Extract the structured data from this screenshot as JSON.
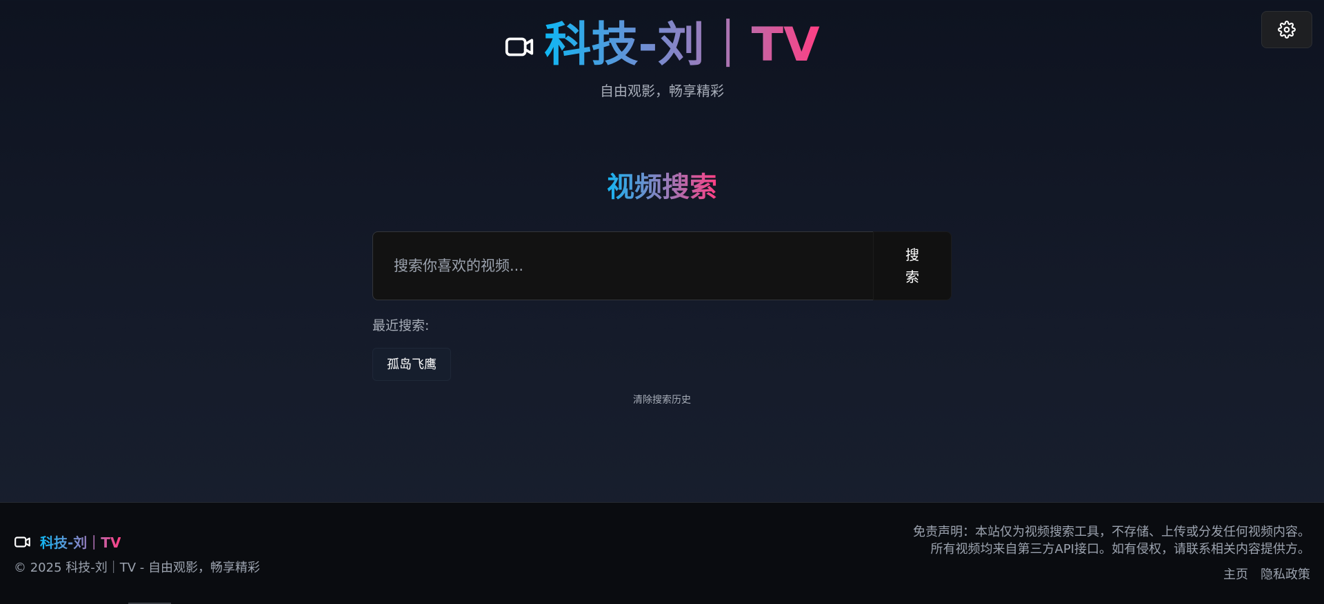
{
  "header": {
    "title": "科技-刘｜TV",
    "tagline": "自由观影，畅享精彩",
    "logo_icon": "video-camera-icon",
    "settings_icon": "gear-icon"
  },
  "search": {
    "heading": "视频搜索",
    "placeholder": "搜索你喜欢的视频...",
    "value": "",
    "button_label": "搜索",
    "recent_label": "最近搜索:",
    "recent_items": [
      "孤岛飞鹰"
    ],
    "clear_label": "清除搜索历史"
  },
  "footer": {
    "brand": "科技-刘｜TV",
    "copyright": "© 2025 科技-刘｜TV - 自由观影，畅享精彩",
    "disclaimer_line1": "免责声明：本站仅为视频搜索工具，不存储、上传或分发任何视频内容。",
    "disclaimer_line2": "所有视频均来自第三方API接口。如有侵权，请联系相关内容提供方。",
    "links": [
      "主页",
      "隐私政策"
    ]
  },
  "colors": {
    "background": "#0e1320",
    "brand_gradient_start": "#0fb7f3",
    "brand_gradient_end": "#ff3f84",
    "muted_text": "#a7adb8"
  }
}
